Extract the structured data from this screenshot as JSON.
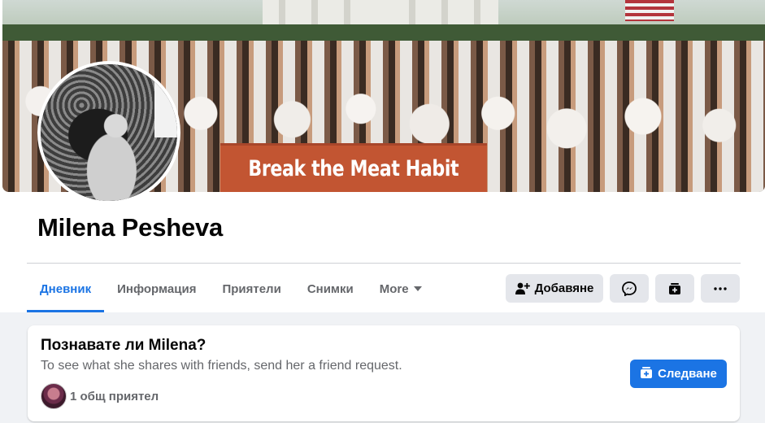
{
  "cover": {
    "banner_text": "Break the Meat Habit"
  },
  "profile": {
    "name": "Milena Pesheva"
  },
  "tabs": [
    {
      "label": "Дневник",
      "active": true
    },
    {
      "label": "Информация",
      "active": false
    },
    {
      "label": "Приятели",
      "active": false
    },
    {
      "label": "Снимки",
      "active": false
    },
    {
      "label": "More",
      "active": false
    }
  ],
  "actions": {
    "add_friend_label": "Добавяне",
    "add_friend_icon": "add-friend-icon",
    "message_icon": "messenger-icon",
    "follow_icon": "follow-icon",
    "more_icon": "more-dots-icon"
  },
  "know_card": {
    "title": "Познавате ли Milena?",
    "subtitle": "To see what she shares with friends, send her a friend request.",
    "mutual_friends": "1 общ приятел",
    "follow_label": "Следване"
  },
  "colors": {
    "accent": "#1b74e4",
    "secondary_text": "#65676b",
    "button_gray": "#e4e6eb",
    "page_background": "#f0f2f5"
  }
}
